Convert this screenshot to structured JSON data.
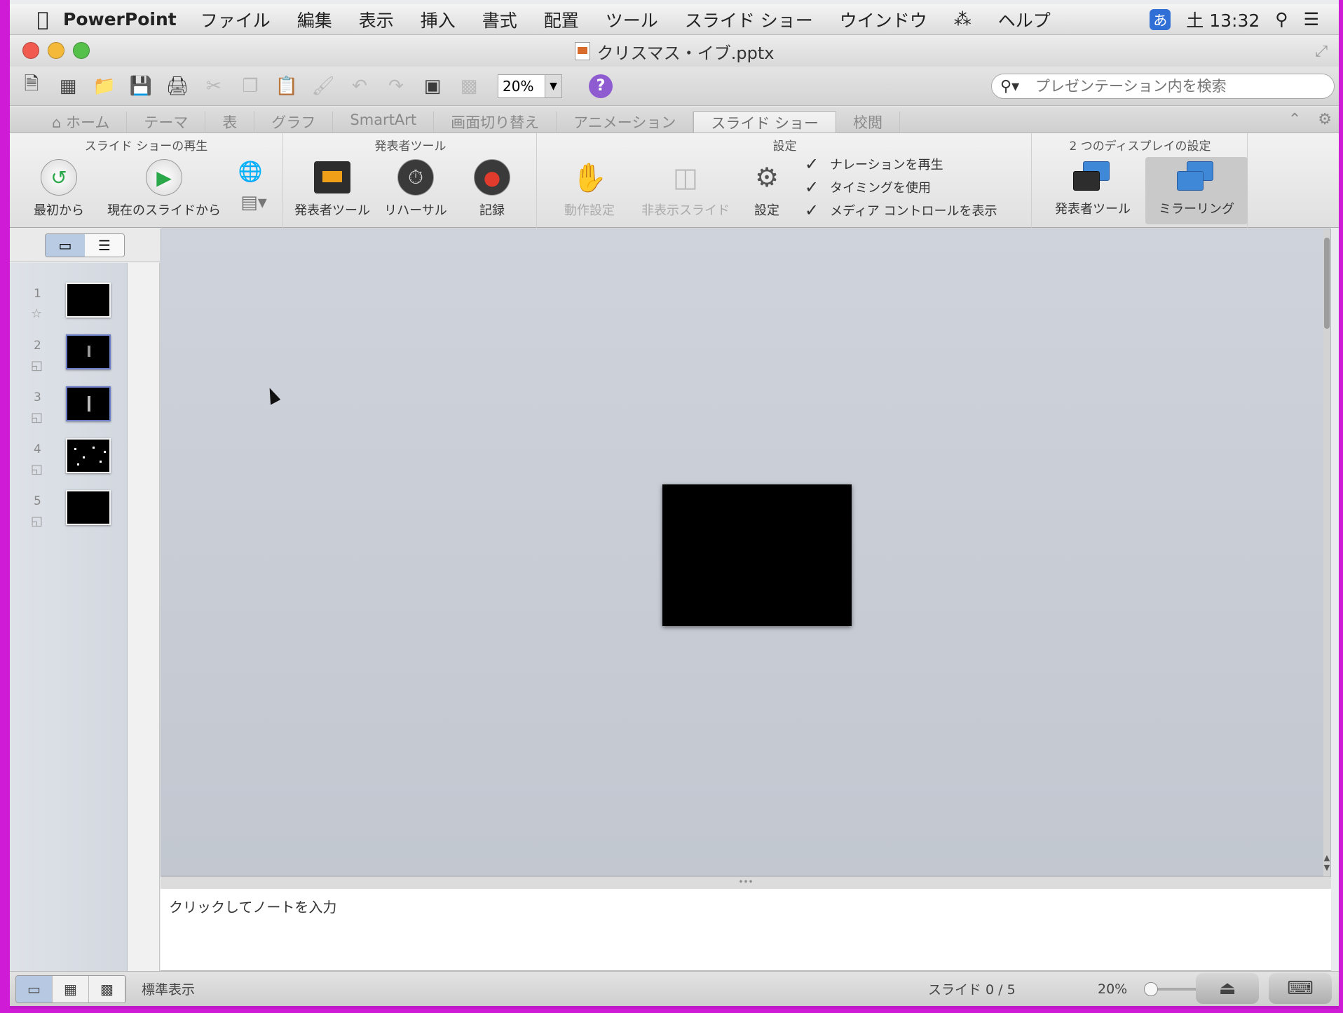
{
  "menubar": {
    "apple_icon": "apple-icon",
    "app_name": "PowerPoint",
    "items": [
      "ファイル",
      "編集",
      "表示",
      "挿入",
      "書式",
      "配置",
      "ツール",
      "スライド ショー",
      "ウインドウ",
      "ヘルプ"
    ],
    "ime": "あ",
    "clock": "土 13:32"
  },
  "window": {
    "title": "クリスマス・イブ.pptx"
  },
  "toolbar": {
    "zoom_value": "20%",
    "help_label": "?",
    "search_placeholder": "プレゼンテーション内を検索"
  },
  "ribbon_tabs": {
    "tabs": [
      "ホーム",
      "テーマ",
      "表",
      "グラフ",
      "SmartArt",
      "画面切り替え",
      "アニメーション",
      "スライド ショー",
      "校閲"
    ],
    "active": "スライド ショー"
  },
  "ribbon": {
    "group_play": {
      "title": "スライド ショーの再生",
      "from_start": "最初から",
      "from_current": "現在のスライドから"
    },
    "group_presenter": {
      "title": "発表者ツール",
      "presenter_tools": "発表者ツール",
      "rehearse": "リハーサル",
      "record": "記録"
    },
    "group_settings": {
      "title": "設定",
      "action_settings": "動作設定",
      "hide_slide": "非表示スライド",
      "setup": "設定",
      "checks": [
        {
          "label": "ナレーションを再生",
          "checked": true
        },
        {
          "label": "タイミングを使用",
          "checked": true
        },
        {
          "label": "メディア コントロールを表示",
          "checked": true
        }
      ]
    },
    "group_display": {
      "title": "2 つのディスプレイの設定",
      "presenter_tools": "発表者ツール",
      "mirroring": "ミラーリング"
    }
  },
  "thumbnails": [
    {
      "number": "1"
    },
    {
      "number": "2"
    },
    {
      "number": "3"
    },
    {
      "number": "4"
    },
    {
      "number": "5"
    }
  ],
  "notes": {
    "placeholder": "クリックしてノートを入力"
  },
  "statusbar": {
    "view_name": "標準表示",
    "slide_counter": "スライド 0 / 5",
    "zoom": "20%"
  },
  "colors": {
    "accent_blue": "#3f88d8",
    "record_red": "#e03b2c",
    "play_green": "#2aa84a",
    "frame_magenta": "#cf1bd6"
  }
}
